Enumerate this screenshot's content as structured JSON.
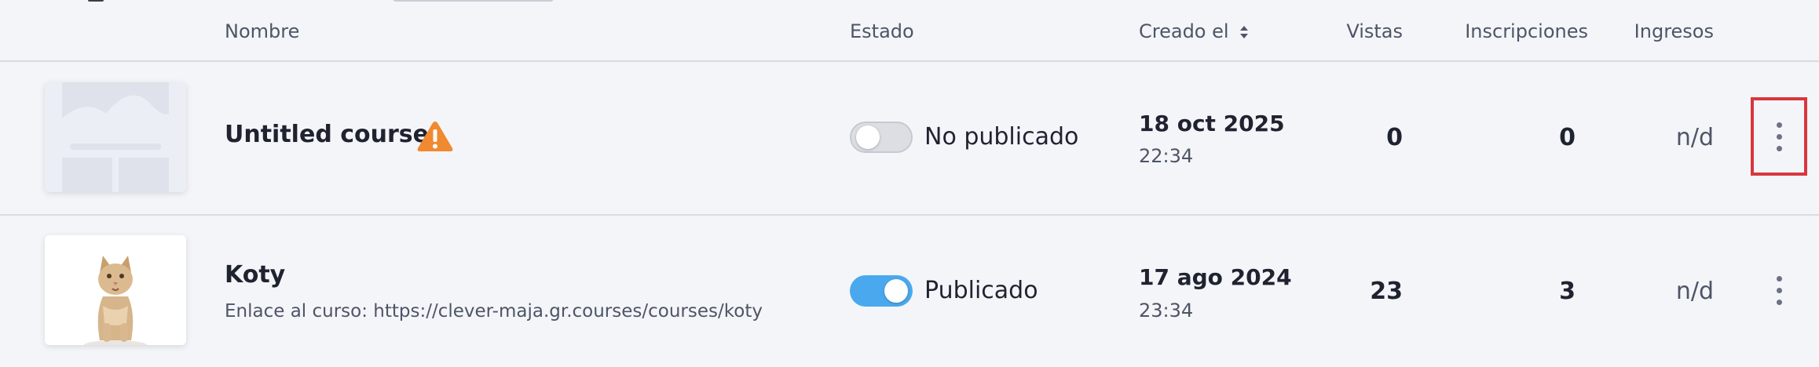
{
  "table": {
    "headers": {
      "name": "Nombre",
      "status": "Estado",
      "created": "Creado el",
      "views": "Vistas",
      "enrollments": "Inscripciones",
      "revenue": "Ingresos"
    },
    "rows": [
      {
        "title": "Untitled course",
        "link_text": "",
        "has_warning": true,
        "published": false,
        "status_label": "No publicado",
        "date": "18 oct 2025",
        "time": "22:34",
        "views": "0",
        "enrollments": "0",
        "revenue": "n/d",
        "thumbnail": "placeholder-image-icon"
      },
      {
        "title": "Koty",
        "link_text": "Enlace al curso: https://clever-maja.gr.courses/courses/koty",
        "has_warning": false,
        "published": true,
        "status_label": "Publicado",
        "date": "17 ago 2024",
        "time": "23:34",
        "views": "23",
        "enrollments": "3",
        "revenue": "n/d",
        "thumbnail": "kitten-photo"
      }
    ]
  },
  "colors": {
    "accent_toggle_on": "#4aa9ee",
    "warning": "#f0892f",
    "highlight_box": "#d9363e"
  }
}
